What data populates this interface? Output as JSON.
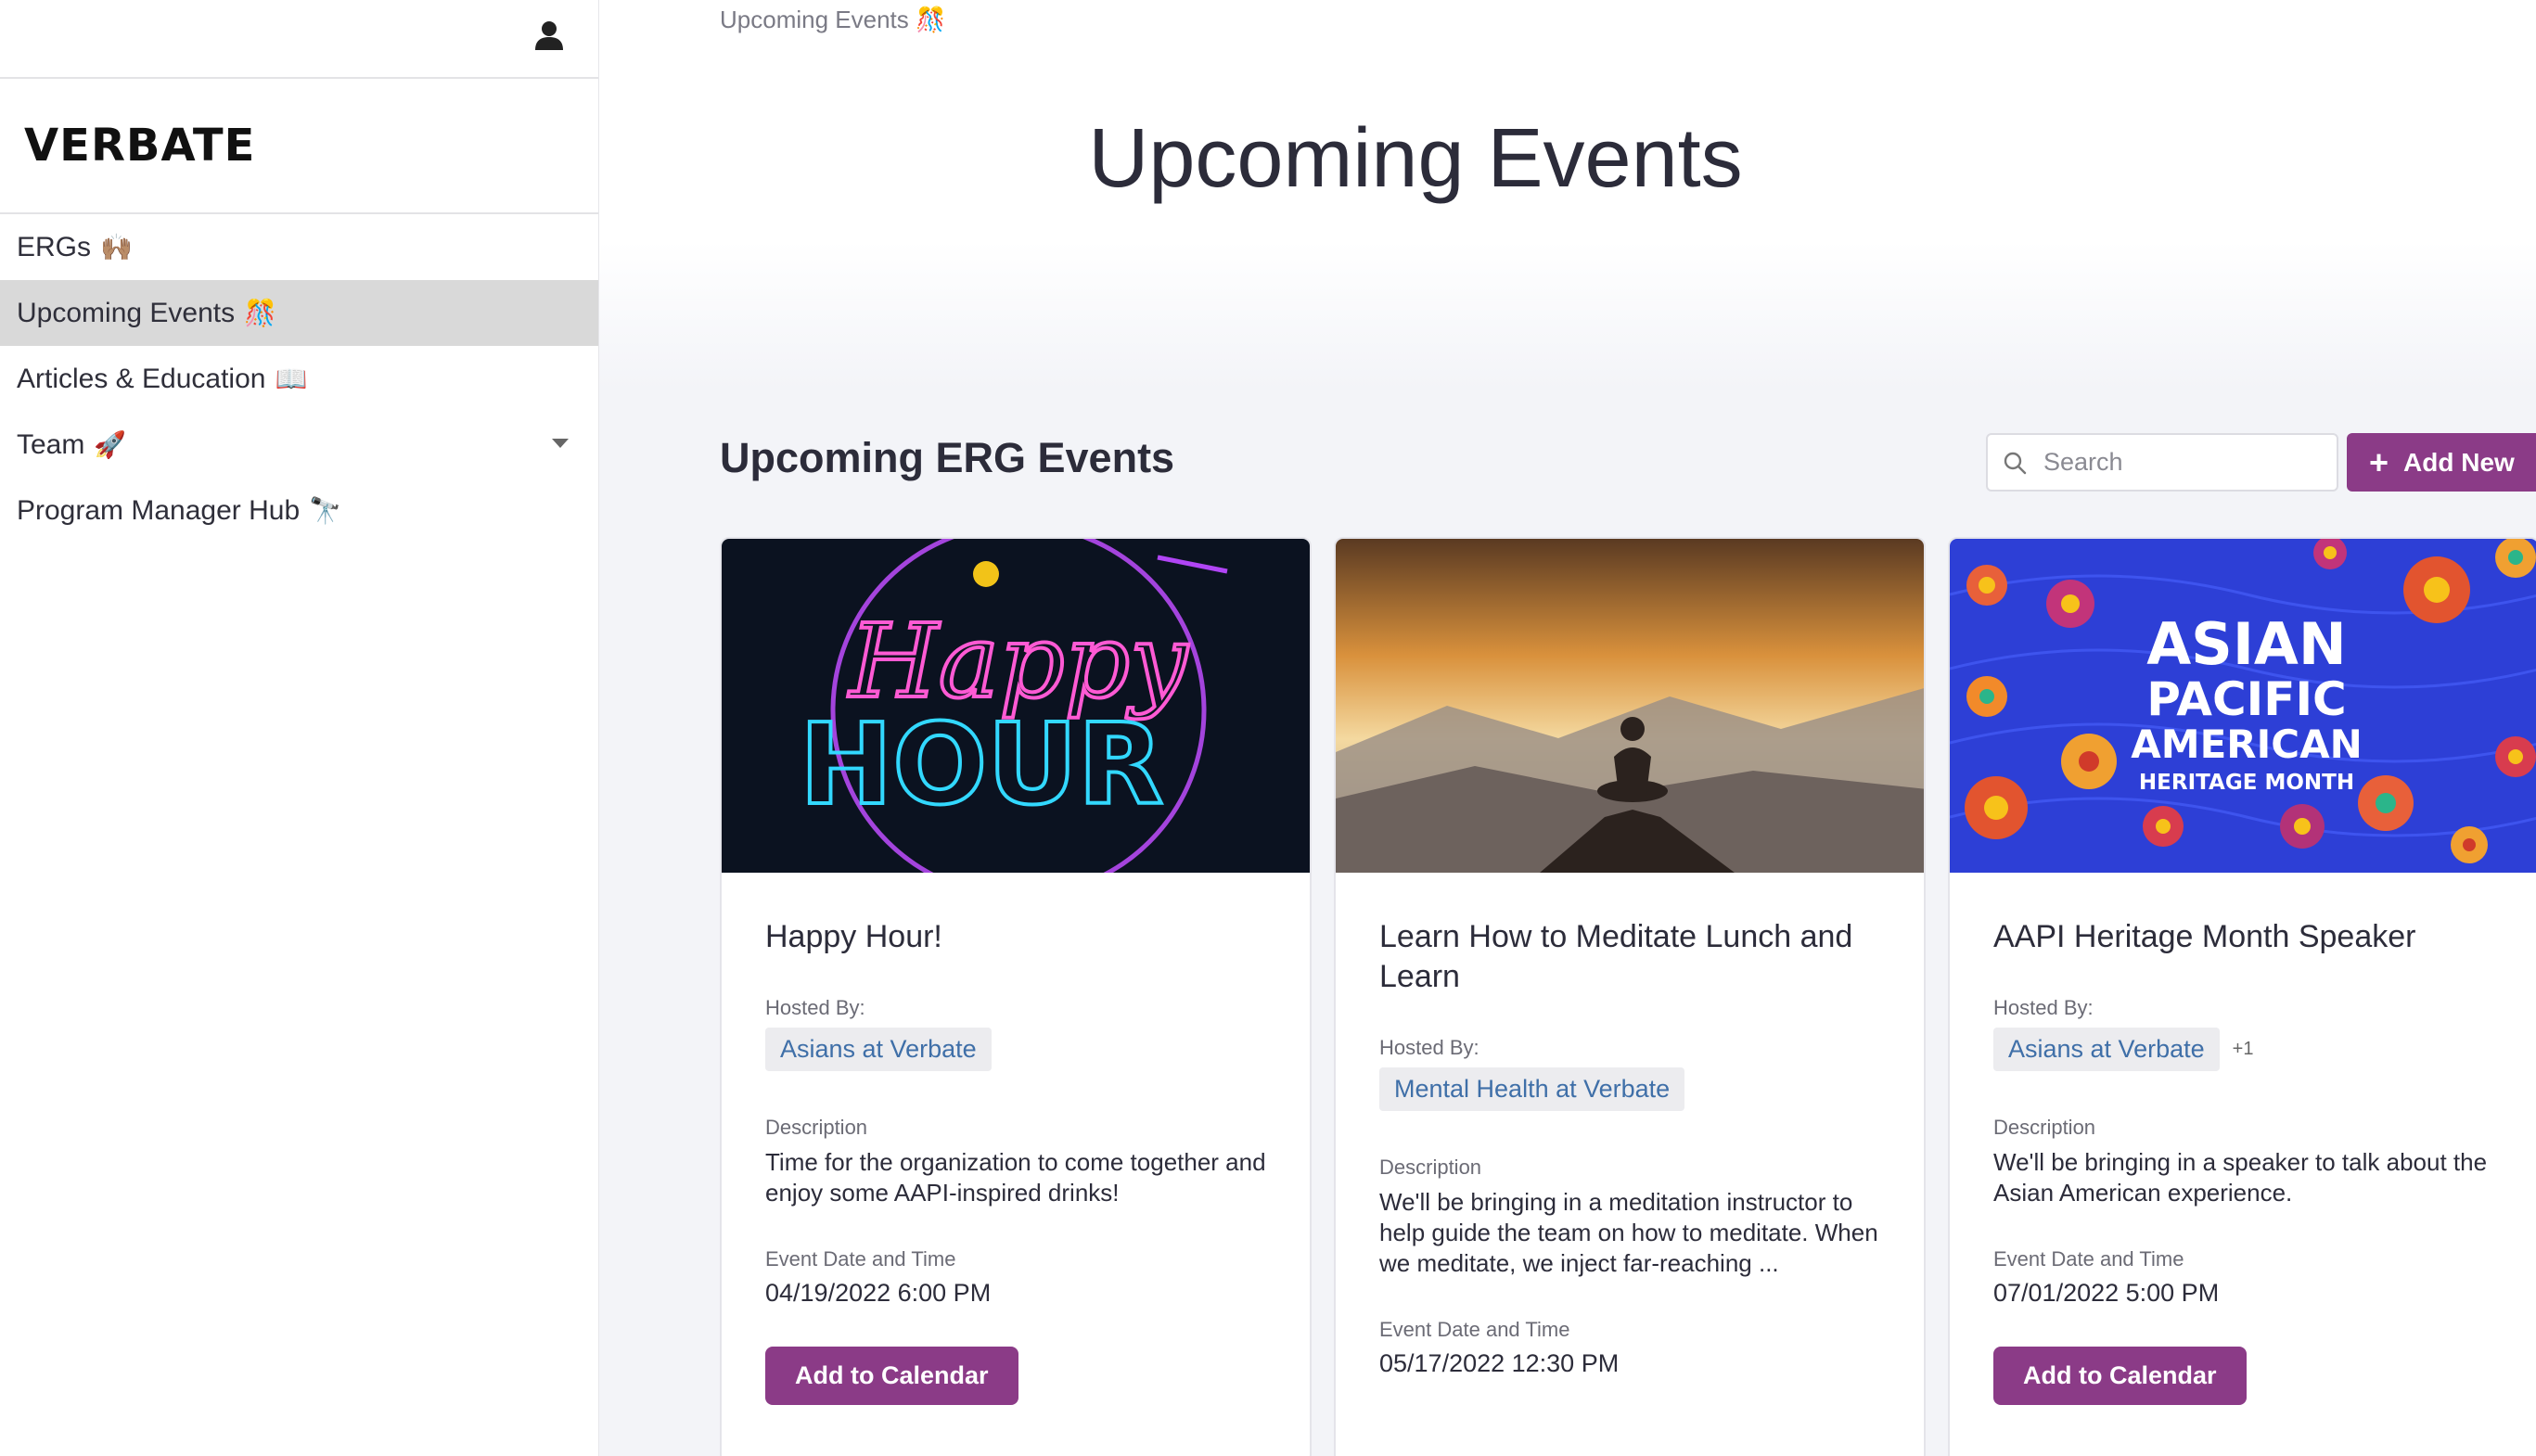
{
  "sidebar": {
    "logo": "VERBATE",
    "items": [
      {
        "label": "ERGs",
        "emoji": "🙌🏽"
      },
      {
        "label": "Upcoming Events",
        "emoji": "🎊"
      },
      {
        "label": "Articles & Education",
        "emoji": "📖"
      },
      {
        "label": "Team",
        "emoji": "🚀"
      },
      {
        "label": "Program Manager Hub",
        "emoji": "🔭"
      }
    ],
    "active_index": 1
  },
  "breadcrumb": {
    "label": "Upcoming Events",
    "emoji": "🎊"
  },
  "page": {
    "title": "Upcoming Events"
  },
  "section": {
    "title": "Upcoming ERG Events"
  },
  "search": {
    "placeholder": "Search",
    "value": ""
  },
  "toolbar": {
    "add_new_label": "Add New"
  },
  "labels": {
    "hosted_by": "Hosted By:",
    "description": "Description",
    "event_date": "Event Date and Time",
    "add_to_calendar": "Add to Calendar"
  },
  "events": [
    {
      "title": "Happy Hour!",
      "host": "Asians at Verbate",
      "host_extra": "",
      "description": "Time for the organization to come together and enjoy some AAPI-inspired drinks!",
      "datetime": "04/19/2022 6:00 PM",
      "image_text_1": "Happy",
      "image_text_2": "HOUR"
    },
    {
      "title": "Learn How to Meditate Lunch and Learn",
      "host": "Mental Health at Verbate",
      "host_extra": "",
      "description": "We'll be bringing in a meditation instructor to help guide the team on how to meditate. When we meditate, we inject far-reaching ...",
      "datetime": "05/17/2022 12:30 PM"
    },
    {
      "title": "AAPI Heritage Month Speaker",
      "host": "Asians at Verbate",
      "host_extra": "+1",
      "description": "We'll be bringing in a speaker to talk about the Asian American experience.",
      "datetime": "07/01/2022 5:00 PM",
      "image_line_1": "ASIAN",
      "image_line_2": "PACIFIC",
      "image_line_3": "AMERICAN",
      "image_line_4": "HERITAGE MONTH"
    }
  ],
  "colors": {
    "accent": "#8b3b87",
    "link": "#3f6fa8",
    "active_nav": "#d9d9d9"
  }
}
